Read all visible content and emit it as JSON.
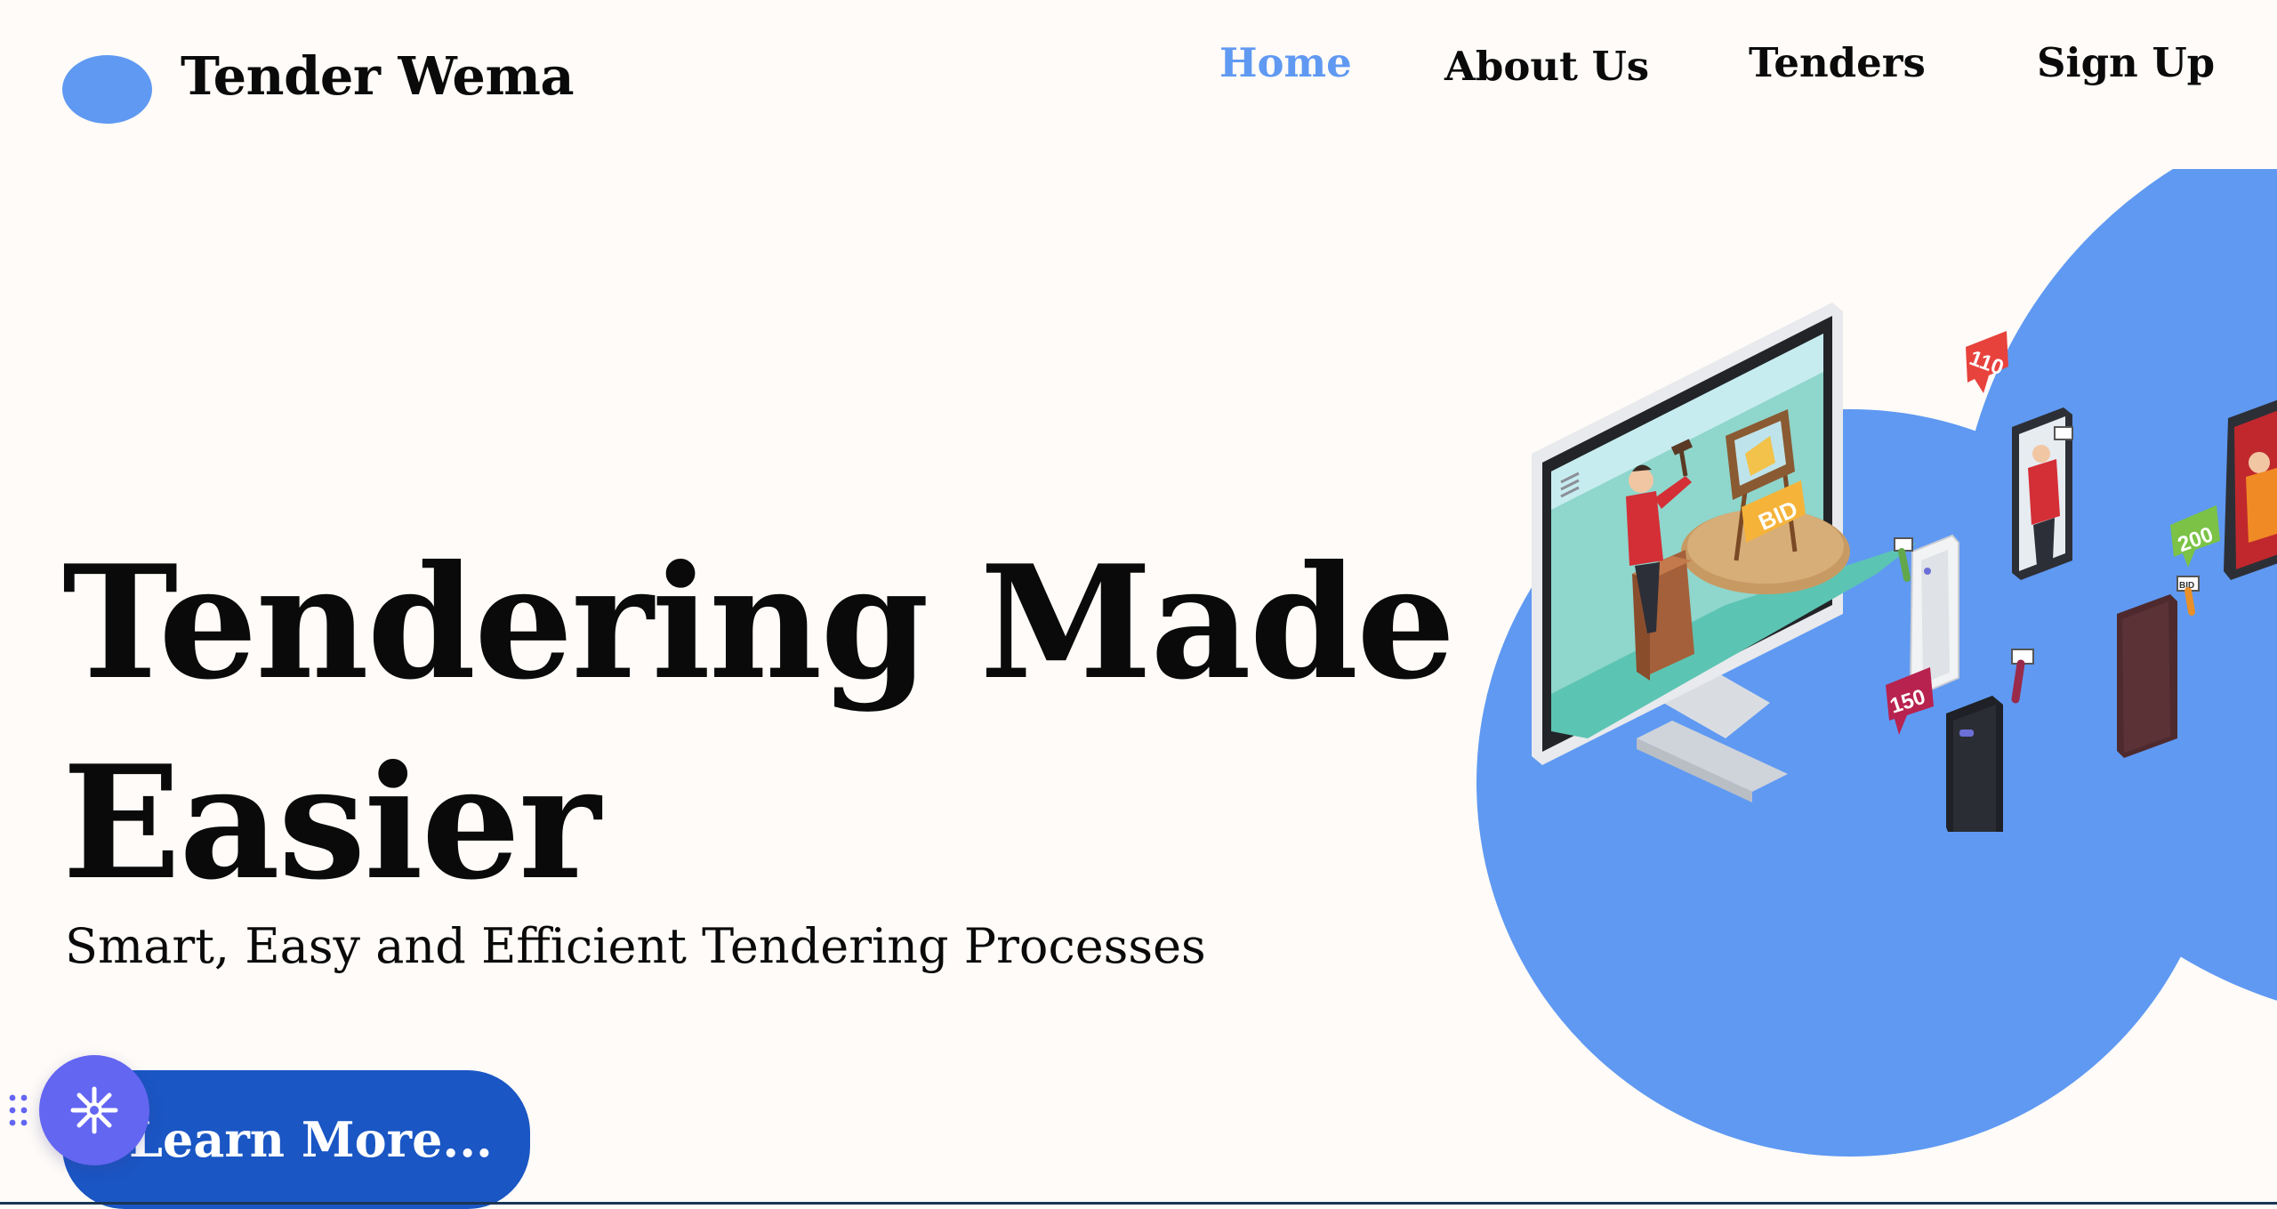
{
  "header": {
    "brand": "Tender Wema",
    "nav": [
      {
        "label": "Home",
        "active": true
      },
      {
        "label": "About Us",
        "active": false
      },
      {
        "label": "Tenders",
        "active": false
      },
      {
        "label": "Sign Up",
        "active": false
      }
    ]
  },
  "hero": {
    "title_line1": "Tendering Made",
    "title_line2": "Easier",
    "subtitle": "Smart, Easy and Efficient Tendering Processes",
    "cta_label": "Learn More...",
    "illustration": {
      "screen_sign": "BID",
      "bubbles": [
        "110",
        "150",
        "200"
      ],
      "phone_sign": "BID"
    }
  },
  "widget": {
    "icon": "sparkle-icon",
    "handle_icon": "drag-handle-icon"
  },
  "colors": {
    "accent": "#5f99f2",
    "cta": "#1a56c4",
    "widget": "#6366f1",
    "background": "#fefbf8"
  }
}
